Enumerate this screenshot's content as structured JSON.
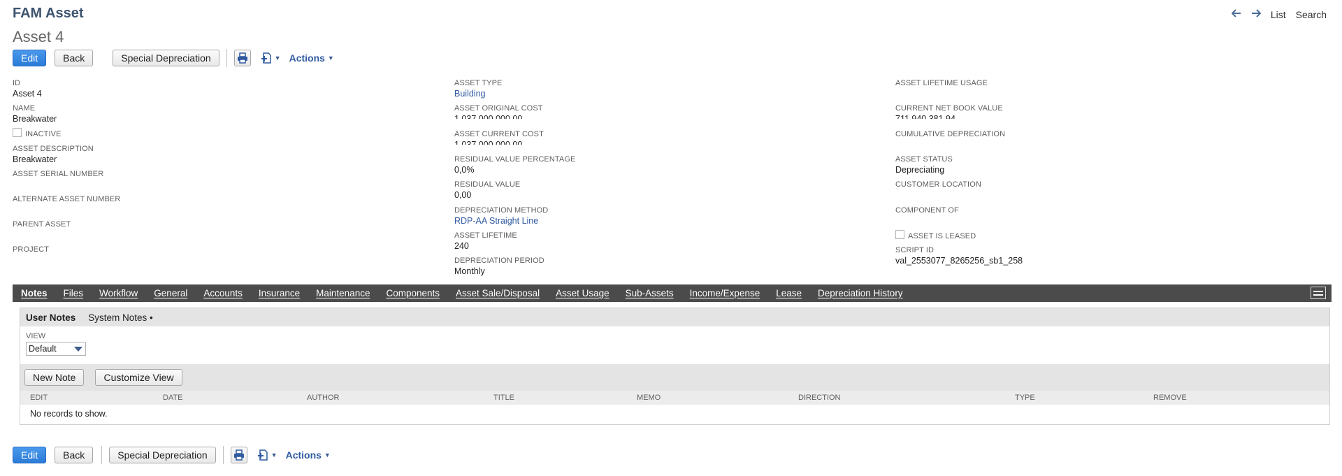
{
  "header": {
    "record_type": "FAM Asset",
    "record_name": "Asset 4",
    "nav": {
      "list": "List",
      "search": "Search"
    }
  },
  "buttons": {
    "edit": "Edit",
    "back": "Back",
    "special_depreciation": "Special Depreciation",
    "actions": "Actions"
  },
  "fields": {
    "col1": [
      {
        "label": "ID",
        "value": "Asset 4"
      },
      {
        "label": "NAME",
        "value": "Breakwater"
      },
      {
        "label": "INACTIVE",
        "checkbox": true
      },
      {
        "label": "ASSET DESCRIPTION",
        "value": "Breakwater"
      },
      {
        "label": "ASSET SERIAL NUMBER",
        "value": ""
      },
      {
        "label": "ALTERNATE ASSET NUMBER",
        "value": ""
      },
      {
        "label": "PARENT ASSET",
        "value": ""
      },
      {
        "label": "PROJECT",
        "value": ""
      }
    ],
    "col2": [
      {
        "label": "ASSET TYPE",
        "value": "Building"
      },
      {
        "label": "ASSET ORIGINAL COST",
        "value": "1.037.000.000,00"
      },
      {
        "label": "ASSET CURRENT COST",
        "value": "1.037.000.000,00"
      },
      {
        "label": "RESIDUAL VALUE PERCENTAGE",
        "value": "0,0%"
      },
      {
        "label": "RESIDUAL VALUE",
        "value": "0,00"
      },
      {
        "label": "DEPRECIATION METHOD",
        "value": "RDP-AA Straight Line"
      },
      {
        "label": "ASSET LIFETIME",
        "value": "240"
      },
      {
        "label": "DEPRECIATION PERIOD",
        "value": "Monthly"
      }
    ],
    "col3": [
      {
        "label": "ASSET LIFETIME USAGE",
        "value": ""
      },
      {
        "label": "CURRENT NET BOOK VALUE",
        "value": "711.940.381,94"
      },
      {
        "label": "CUMULATIVE DEPRECIATION",
        "value": ""
      },
      {
        "label": "ASSET STATUS",
        "value": "Depreciating"
      },
      {
        "label": "CUSTOMER LOCATION",
        "value": ""
      },
      {
        "label": "COMPONENT OF",
        "value": ""
      },
      {
        "label": "ASSET IS LEASED",
        "checkbox": true
      },
      {
        "label": "SCRIPT ID",
        "value": "val_2553077_8265256_sb1_258"
      }
    ]
  },
  "tabs": [
    "Notes",
    "Files",
    "Workflow",
    "General",
    "Accounts",
    "Insurance",
    "Maintenance",
    "Components",
    "Asset Sale/Disposal",
    "Asset Usage",
    "Sub-Assets",
    "Income/Expense",
    "Lease",
    "Depreciation History"
  ],
  "notes": {
    "subtabs": [
      "User Notes",
      "System Notes •"
    ],
    "view_label": "VIEW",
    "view_value": "Default",
    "new_note": "New Note",
    "customize_view": "Customize View",
    "columns": [
      "EDIT",
      "DATE",
      "AUTHOR",
      "TITLE",
      "MEMO",
      "DIRECTION",
      "TYPE",
      "REMOVE"
    ],
    "empty": "No records to show."
  },
  "colors": {
    "header_title": "#3d5470",
    "link": "#2f5aa0",
    "primary_button": "#2a7bd8",
    "tabbar": "#4b4b4b"
  }
}
